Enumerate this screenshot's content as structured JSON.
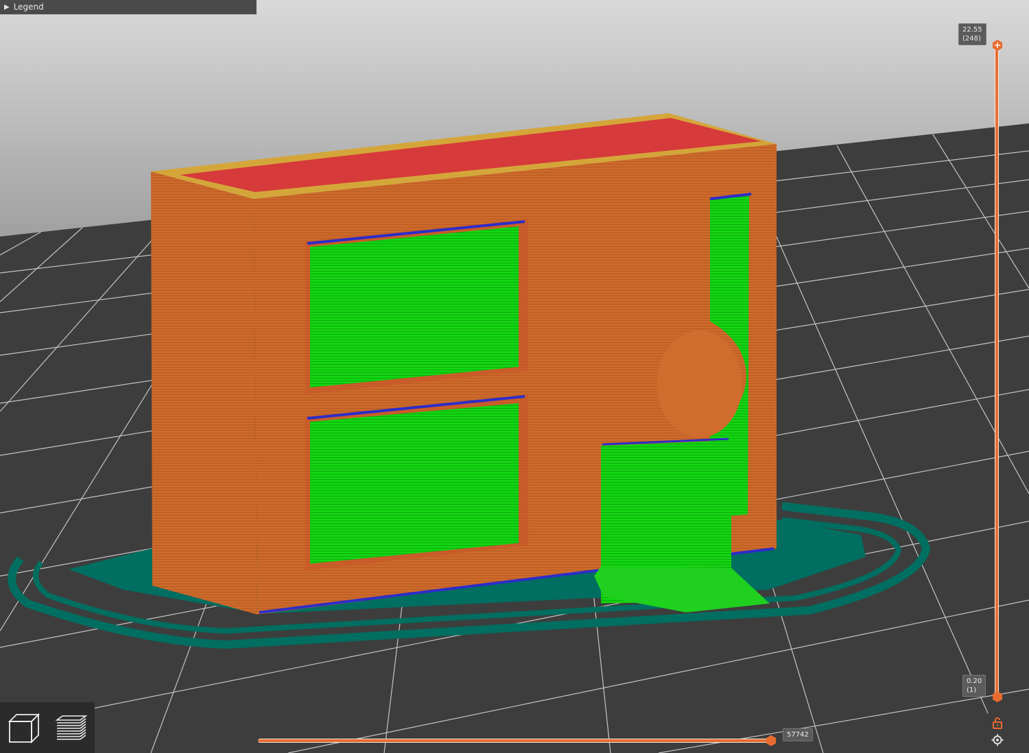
{
  "legend": {
    "label": "Legend",
    "collapsed": true
  },
  "layer_slider": {
    "top_height": "22.55",
    "top_layer": "(248)",
    "bottom_height": "0.20",
    "bottom_layer": "(1)"
  },
  "move_slider": {
    "value": "57742"
  },
  "view_modes": {
    "items": [
      {
        "icon": "3d-cube-icon"
      },
      {
        "icon": "layers-icon"
      }
    ]
  },
  "colors": {
    "background": "#3f3f3f",
    "grid_line": "#c7c7c7",
    "sky_top": "#dcdcdc",
    "sky_bottom": "#9d9d9d",
    "perimeter": "#cd6a2b",
    "infill_solid": "#e03a3a",
    "support": "#1fd01f",
    "bridge": "#2d2dc8",
    "skirt": "#006e60",
    "accent": "#e76b2f"
  },
  "icons": [
    "lock-icon",
    "settings-gear-icon",
    "plus-icon"
  ]
}
